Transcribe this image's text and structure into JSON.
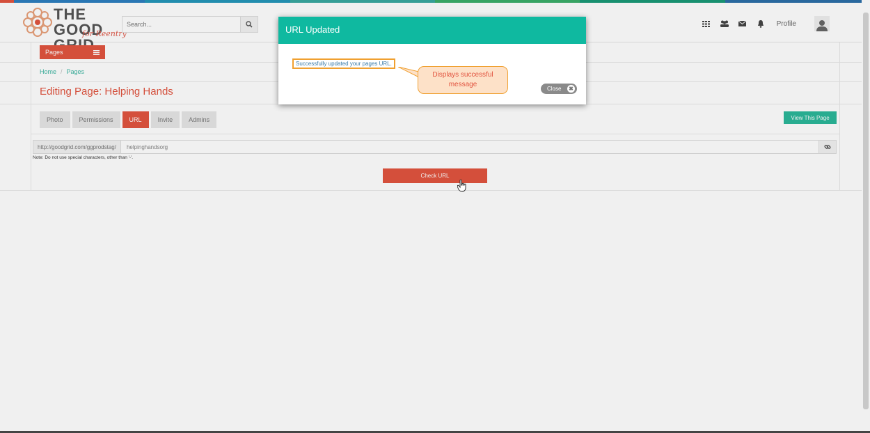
{
  "colors": {
    "accent_red": "#e2543f",
    "teal": "#0fb9a0",
    "link_teal": "#3bb5a1",
    "highlight_orange": "#f0a030",
    "callout_fill": "#fde1c8"
  },
  "logo": {
    "brand_line1": "THE GOOD",
    "brand_line2": "GRID",
    "brand_sub": "for Reentry",
    "icon": "flower-logo-icon"
  },
  "search": {
    "placeholder": "Search...",
    "icon": "search-icon"
  },
  "header_icons": [
    "grid-icon",
    "users-icon",
    "envelope-icon",
    "bell-icon"
  ],
  "profile": {
    "label": "Profile",
    "icon": "user-avatar-icon"
  },
  "pages_button": {
    "label": "Pages",
    "icon": "menu-icon"
  },
  "breadcrumb": {
    "home": "Home",
    "separator": "/",
    "current": "Pages"
  },
  "page_title": "Editing Page: Helping Hands",
  "tabs": [
    {
      "label": "Photo",
      "active": false
    },
    {
      "label": "Permissions",
      "active": false
    },
    {
      "label": "URL",
      "active": true
    },
    {
      "label": "Invite",
      "active": false
    },
    {
      "label": "Admins",
      "active": false
    }
  ],
  "view_page_button": "View This Page",
  "url_form": {
    "prefix": "http://goodgrid.com/ggprodstag/",
    "value": "helpinghandsorg",
    "link_icon": "link-icon",
    "note": "Note: Do not use special characters, other than '-'.",
    "check_button": "Check URL"
  },
  "modal": {
    "title": "URL Updated",
    "message": "Successfully updated your pages URL.",
    "close_label": "Close",
    "close_icon": "close-icon"
  },
  "annotation": {
    "callout_text": "Displays successful message"
  }
}
